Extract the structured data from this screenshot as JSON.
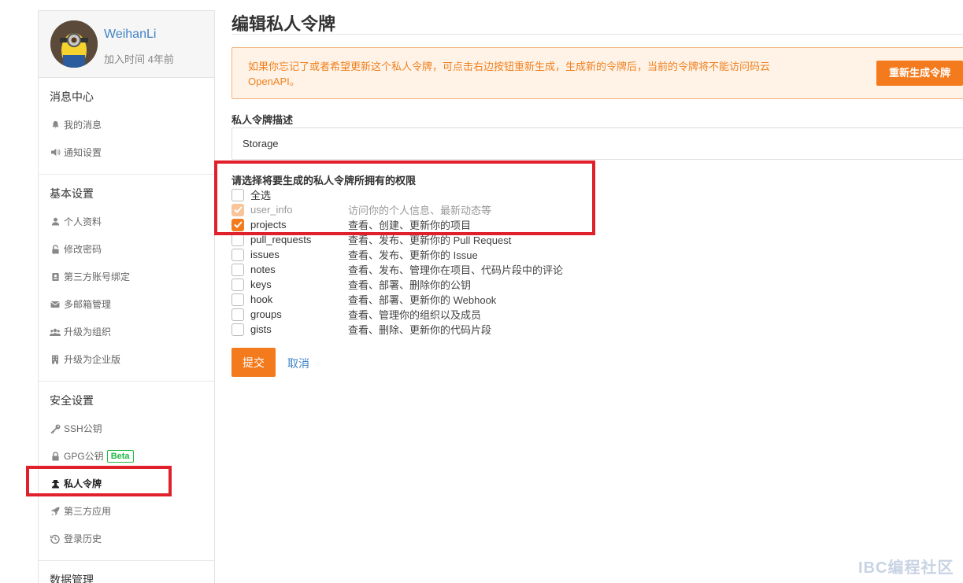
{
  "profile": {
    "username": "WeihanLi",
    "joined": "加入时间 4年前"
  },
  "sidebar": {
    "sections": [
      {
        "title": "消息中心",
        "items": [
          {
            "label": "我的消息",
            "icon": "bell-icon"
          },
          {
            "label": "通知设置",
            "icon": "volume-icon"
          }
        ]
      },
      {
        "title": "基本设置",
        "items": [
          {
            "label": "个人资料",
            "icon": "user-icon"
          },
          {
            "label": "修改密码",
            "icon": "unlock-icon"
          },
          {
            "label": "第三方账号绑定",
            "icon": "id-card-icon"
          },
          {
            "label": "多邮箱管理",
            "icon": "envelope-icon"
          },
          {
            "label": "升级为组织",
            "icon": "users-icon"
          },
          {
            "label": "升级为企业版",
            "icon": "building-icon"
          }
        ]
      },
      {
        "title": "安全设置",
        "items": [
          {
            "label": "SSH公钥",
            "icon": "key-icon"
          },
          {
            "label": "GPG公钥",
            "icon": "lock-icon",
            "badge": "Beta"
          },
          {
            "label": "私人令牌",
            "icon": "user-secret-icon"
          },
          {
            "label": "第三方应用",
            "icon": "rocket-icon"
          },
          {
            "label": "登录历史",
            "icon": "history-icon"
          }
        ]
      },
      {
        "title": "数据管理"
      }
    ]
  },
  "main": {
    "title": "编辑私人令牌",
    "alert": "如果你忘记了或者希望更新这个私人令牌，可点击右边按钮重新生成，生成新的令牌后，当前的令牌将不能访问码云 OpenAPI。",
    "regenerate_label": "重新生成令牌",
    "desc_label": "私人令牌描述",
    "desc_value": "Storage",
    "perm_label": "请选择将要生成的私人令牌所拥有的权限",
    "select_all": "全选",
    "permissions": [
      {
        "name": "user_info",
        "desc": "访问你的个人信息、最新动态等",
        "checked": true,
        "disabled": true
      },
      {
        "name": "projects",
        "desc": "查看、创建、更新你的项目",
        "checked": true,
        "disabled": false
      },
      {
        "name": "pull_requests",
        "desc": "查看、发布、更新你的 Pull Request",
        "checked": false
      },
      {
        "name": "issues",
        "desc": "查看、发布、更新你的 Issue",
        "checked": false
      },
      {
        "name": "notes",
        "desc": "查看、发布、管理你在项目、代码片段中的评论",
        "checked": false
      },
      {
        "name": "keys",
        "desc": "查看、部署、删除你的公钥",
        "checked": false
      },
      {
        "name": "hook",
        "desc": "查看、部署、更新你的 Webhook",
        "checked": false
      },
      {
        "name": "groups",
        "desc": "查看、管理你的组织以及成员",
        "checked": false
      },
      {
        "name": "gists",
        "desc": "查看、删除、更新你的代码片段",
        "checked": false
      }
    ],
    "submit_label": "提交",
    "cancel_label": "取消"
  },
  "watermark": "IBC编程社区",
  "colors": {
    "accent": "#f37b1d",
    "link": "#4183c4",
    "highlight": "#e0202b",
    "badge": "#21ba45"
  }
}
